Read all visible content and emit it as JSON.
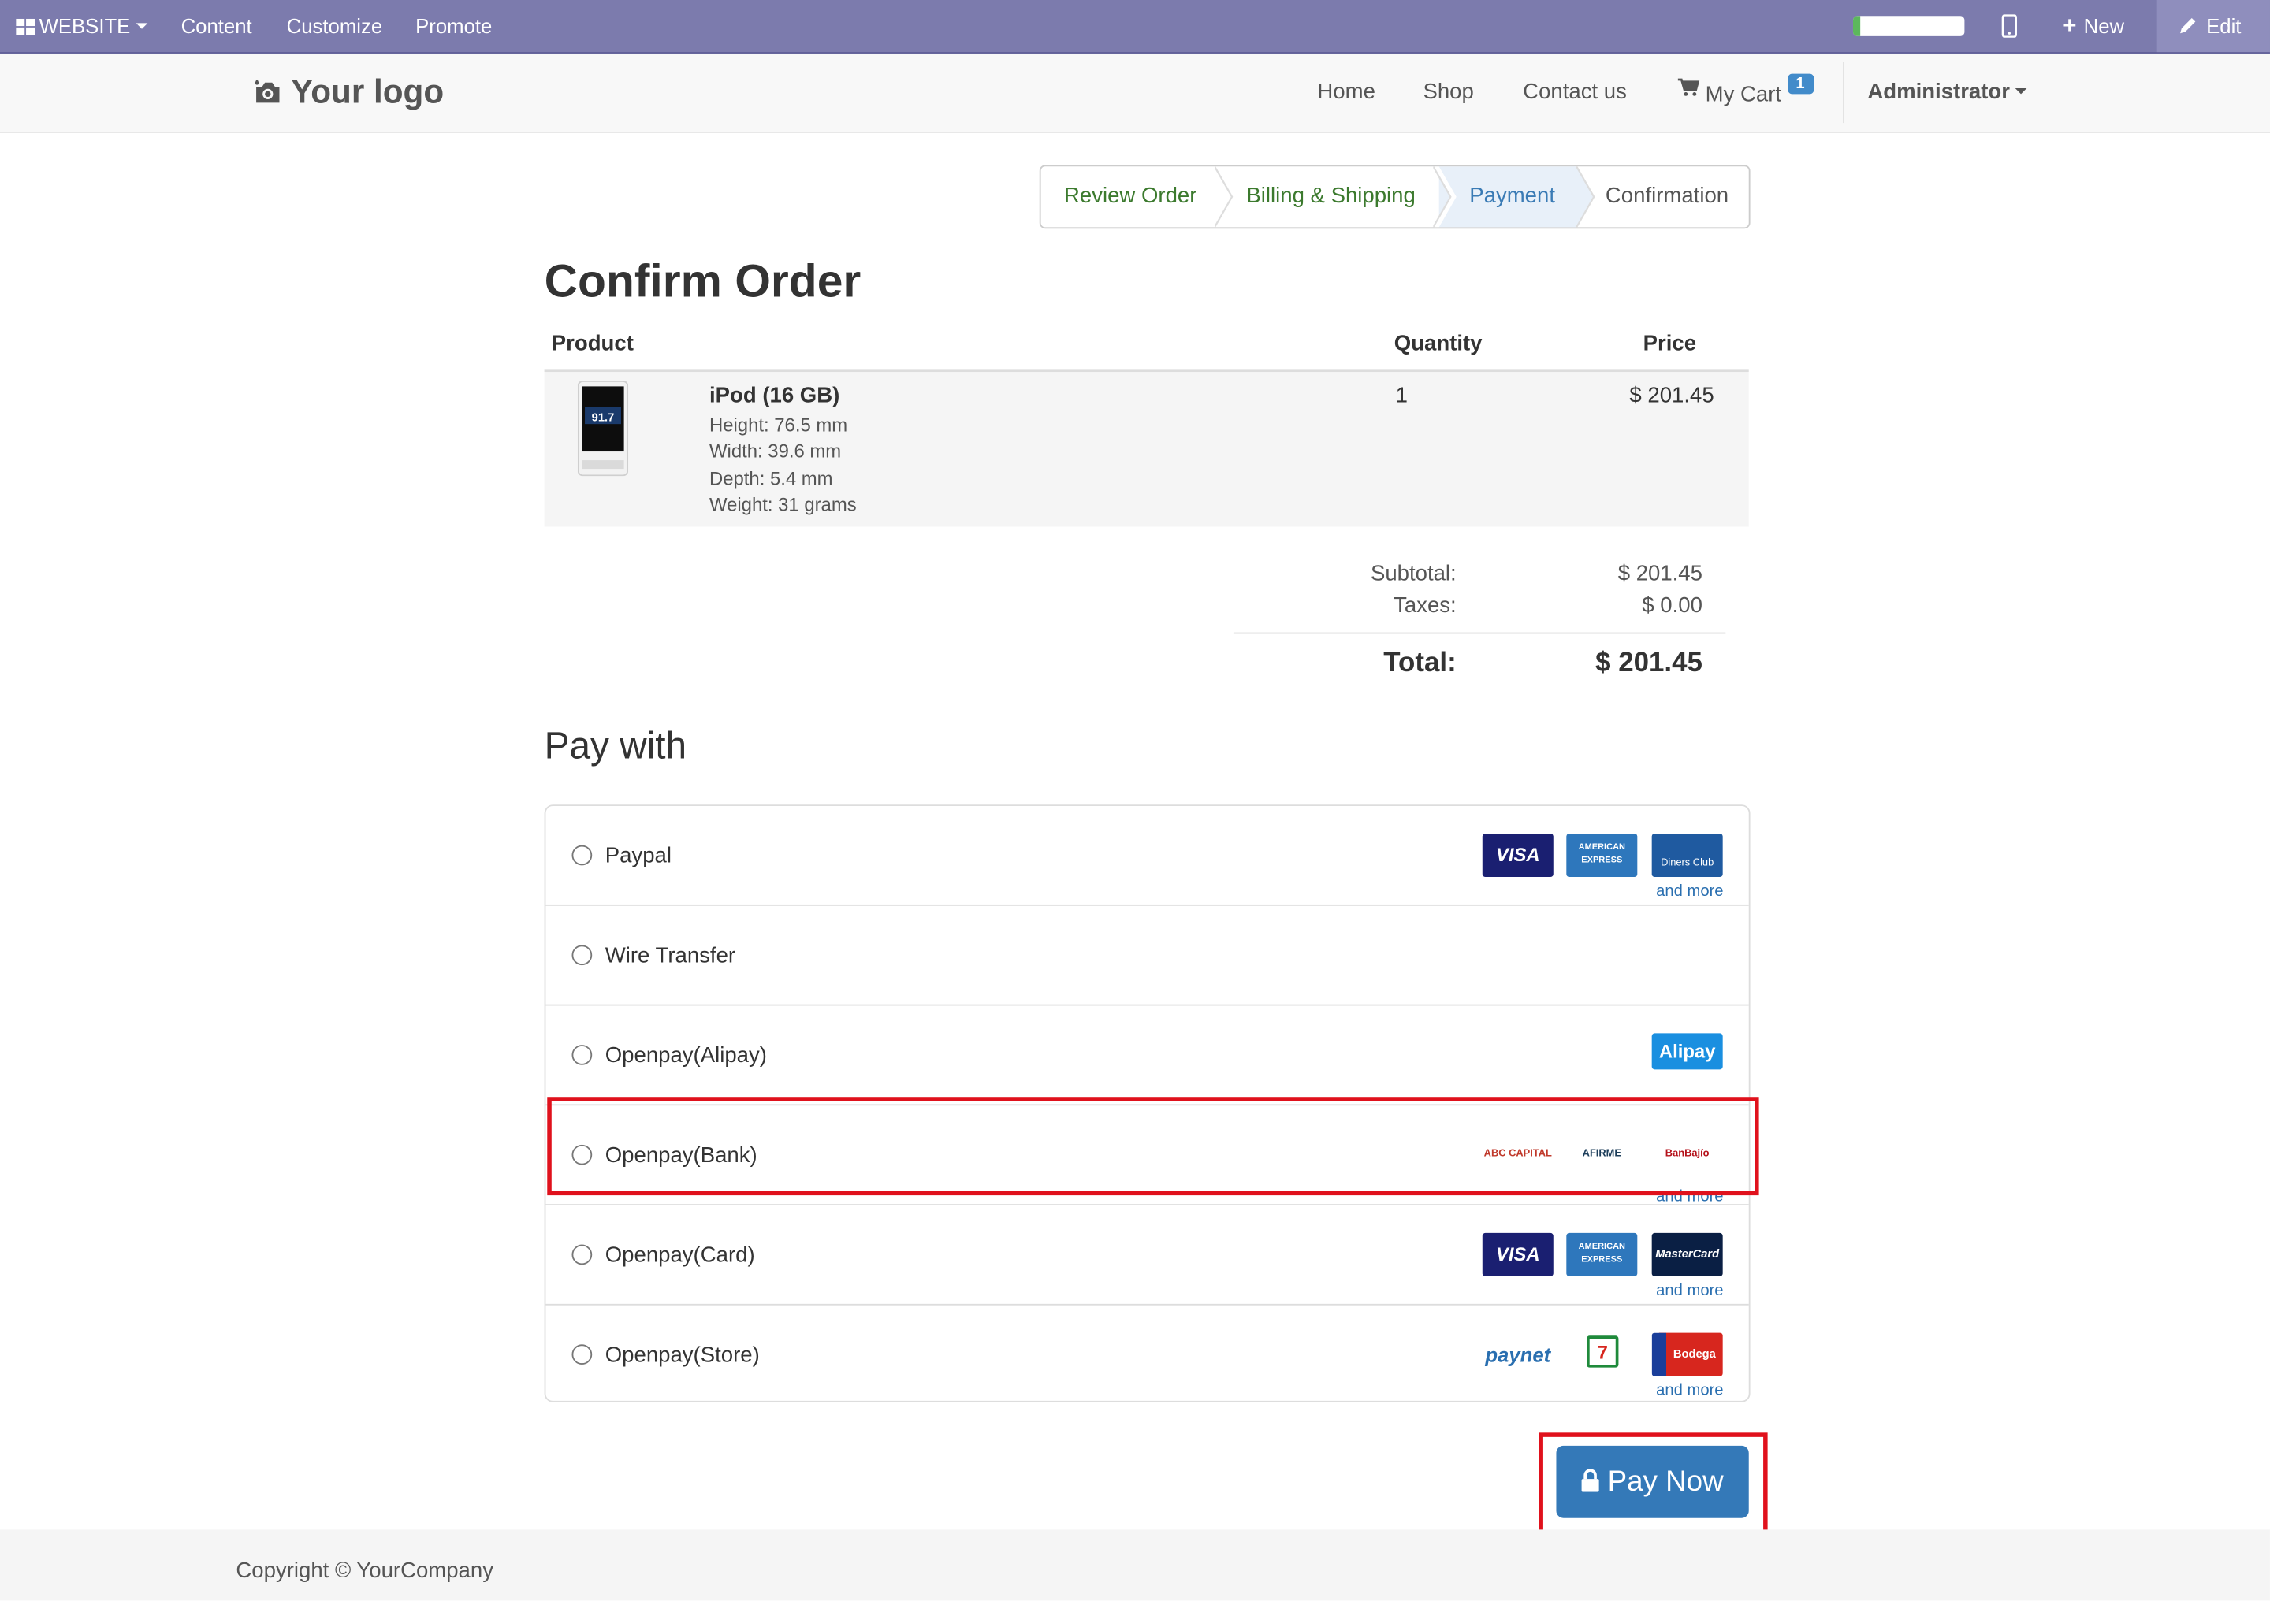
{
  "adminbar": {
    "website_label": "WEBSITE",
    "content_label": "Content",
    "customize_label": "Customize",
    "promote_label": "Promote",
    "progress_fraction": 0.06,
    "new_label": "New",
    "edit_label": "Edit"
  },
  "navbar": {
    "logo_text": "Your logo",
    "links": [
      "Home",
      "Shop",
      "Contact us"
    ],
    "cart_label": "My Cart",
    "cart_count": "1",
    "user_label": "Administrator"
  },
  "wizard": {
    "steps": [
      "Review Order",
      "Billing & Shipping",
      "Payment",
      "Confirmation"
    ],
    "active": "Payment"
  },
  "page_title": "Confirm Order",
  "order": {
    "headers": {
      "product": "Product",
      "quantity": "Quantity",
      "price": "Price"
    },
    "item": {
      "name": "iPod (16 GB)",
      "specs": [
        "Height: 76.5 mm",
        "Width: 39.6 mm",
        "Depth: 5.4 mm",
        "Weight: 31 grams"
      ],
      "quantity": "1",
      "price": "$ 201.45",
      "screen_text": "91.7"
    },
    "subtotal_label": "Subtotal:",
    "subtotal": "$ 201.45",
    "taxes_label": "Taxes:",
    "taxes": "$ 0.00",
    "total_label": "Total:",
    "total": "$ 201.45"
  },
  "pay_with": {
    "title": "Pay with",
    "methods": [
      {
        "label": "Paypal",
        "logos": [
          "VISA",
          "AMERICAN EXPRESS",
          "Diners Club"
        ],
        "more": "and more"
      },
      {
        "label": "Wire Transfer",
        "logos": [],
        "more": ""
      },
      {
        "label": "Openpay(Alipay)",
        "logos": [
          "Alipay"
        ],
        "more": ""
      },
      {
        "label": "Openpay(Bank)",
        "logos": [
          "ABC CAPITAL",
          "AFIRME",
          "BanBajío"
        ],
        "more": "and more"
      },
      {
        "label": "Openpay(Card)",
        "logos": [
          "VISA",
          "AMERICAN EXPRESS",
          "MasterCard"
        ],
        "more": "and more"
      },
      {
        "label": "Openpay(Store)",
        "logos": [
          "paynet",
          "7",
          "Bodega"
        ],
        "more": "and more"
      }
    ],
    "pay_now_label": "Pay Now"
  },
  "footer": {
    "copyright": "Copyright © YourCompany"
  },
  "colors": {
    "adminbar": "#7c7bad",
    "primary": "#3479b8",
    "highlight": "#e0111c",
    "done": "#3c7a2e"
  }
}
